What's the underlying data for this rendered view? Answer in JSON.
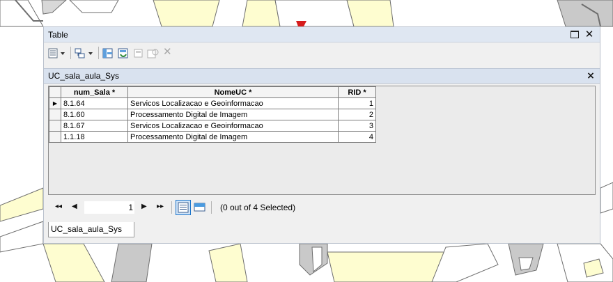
{
  "window": {
    "title": "Table",
    "close_glyph": "✕"
  },
  "toolbar": {
    "icons": [
      "table-options-icon",
      "related-tables-icon",
      "select-by-attributes-icon",
      "switch-selection-icon",
      "clear-selection-icon",
      "zoom-to-selected-icon",
      "delete-selected-icon"
    ],
    "delete_glyph": "✕"
  },
  "tab": {
    "title": "UC_sala_aula_Sys",
    "close_glyph": "×"
  },
  "table": {
    "columns": [
      "num_Sala *",
      "NomeUC *",
      "RID *"
    ],
    "rows": [
      {
        "current": true,
        "num_sala": "8.1.64",
        "nome_uc": "Servicos Localizacao e Geoinformacao",
        "rid": "1"
      },
      {
        "current": false,
        "num_sala": "8.1.60",
        "nome_uc": "Processamento Digital de Imagem",
        "rid": "2"
      },
      {
        "current": false,
        "num_sala": "8.1.67",
        "nome_uc": "Servicos Localizacao e Geoinformacao",
        "rid": "3"
      },
      {
        "current": false,
        "num_sala": "1.1.18",
        "nome_uc": "Processamento Digital de Imagem",
        "rid": "4"
      }
    ],
    "current_row_marker": "▶"
  },
  "navigation": {
    "first_glyph": "⏮",
    "prev_glyph": "◀",
    "next_glyph": "▶",
    "last_glyph": "⏭",
    "current_record": "1",
    "selection_status": "(0 out of 4 Selected)"
  },
  "bottom_tabs": [
    {
      "label": "UC_sala_aula_Sys",
      "active": true
    }
  ],
  "colors": {
    "map_road_fill": "#fefdd0",
    "map_road_outline": "#6e6e6e",
    "map_parcel": "#c9c9c9",
    "title_bar": "#dfe7f2",
    "highlight_blue": "#1a73c9"
  }
}
